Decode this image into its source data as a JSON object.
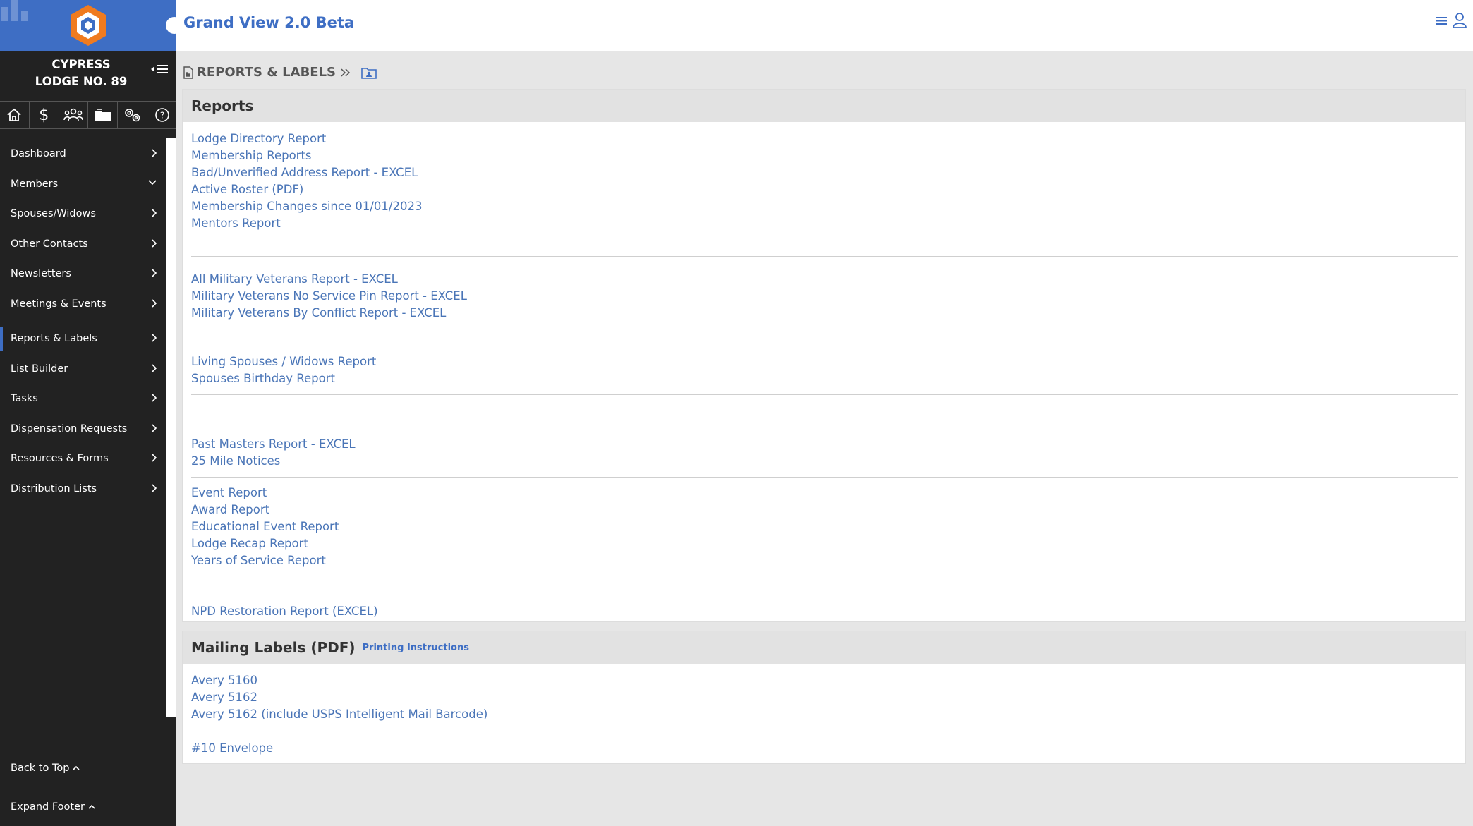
{
  "app": {
    "title": "Grand View 2.0 Beta"
  },
  "sidebar": {
    "lodge_line1": "CYPRESS",
    "lodge_line2": "LODGE NO. 89",
    "icons": [
      "home-icon",
      "dollar-icon",
      "users-icon",
      "folder-icon",
      "settings-icon",
      "help-icon"
    ],
    "items": [
      {
        "label": "Dashboard",
        "chevron": "right"
      },
      {
        "label": "Members",
        "chevron": "down"
      },
      {
        "label": "Spouses/Widows",
        "chevron": "right"
      },
      {
        "label": "Other Contacts",
        "chevron": "right"
      },
      {
        "label": "Newsletters",
        "chevron": "right"
      },
      {
        "label": "Meetings & Events",
        "chevron": "right"
      },
      {
        "label": "Reports & Labels",
        "chevron": "right",
        "active": true
      },
      {
        "label": "List Builder",
        "chevron": "right"
      },
      {
        "label": "Tasks",
        "chevron": "right"
      },
      {
        "label": "Dispensation Requests",
        "chevron": "right"
      },
      {
        "label": "Resources & Forms",
        "chevron": "right"
      },
      {
        "label": "Distribution Lists",
        "chevron": "right"
      }
    ],
    "back_to_top": "Back to Top",
    "expand_footer": "Expand Footer"
  },
  "breadcrumb": {
    "label": "REPORTS & LABELS"
  },
  "reports": {
    "title": "Reports",
    "groups": [
      [
        "Lodge Directory Report",
        "Membership Reports",
        "Bad/Unverified Address Report - EXCEL",
        "Active Roster (PDF)",
        "Membership Changes since 01/01/2023",
        "Mentors Report"
      ],
      [
        "All Military Veterans Report - EXCEL",
        "Military Veterans No Service Pin Report - EXCEL",
        "Military Veterans By Conflict Report - EXCEL"
      ],
      [
        "Living Spouses / Widows Report",
        "Spouses Birthday Report"
      ],
      [
        "Past Masters Report - EXCEL",
        "25 Mile Notices"
      ],
      [
        "Event Report",
        "Award Report",
        "Educational Event Report",
        "Lodge Recap Report",
        "Years of Service Report"
      ],
      [
        "NPD Restoration Report (EXCEL)"
      ]
    ]
  },
  "mailing": {
    "title": "Mailing Labels (PDF)",
    "instructions": "Printing Instructions",
    "links": [
      "Avery 5160",
      "Avery 5162",
      "Avery 5162 (include USPS Intelligent Mail Barcode)"
    ],
    "envelope": "#10 Envelope"
  },
  "colors": {
    "brand": "#3e6ec4",
    "link": "#4a75b7",
    "sidebar": "#222222",
    "logo_orange": "#f07b1f"
  }
}
